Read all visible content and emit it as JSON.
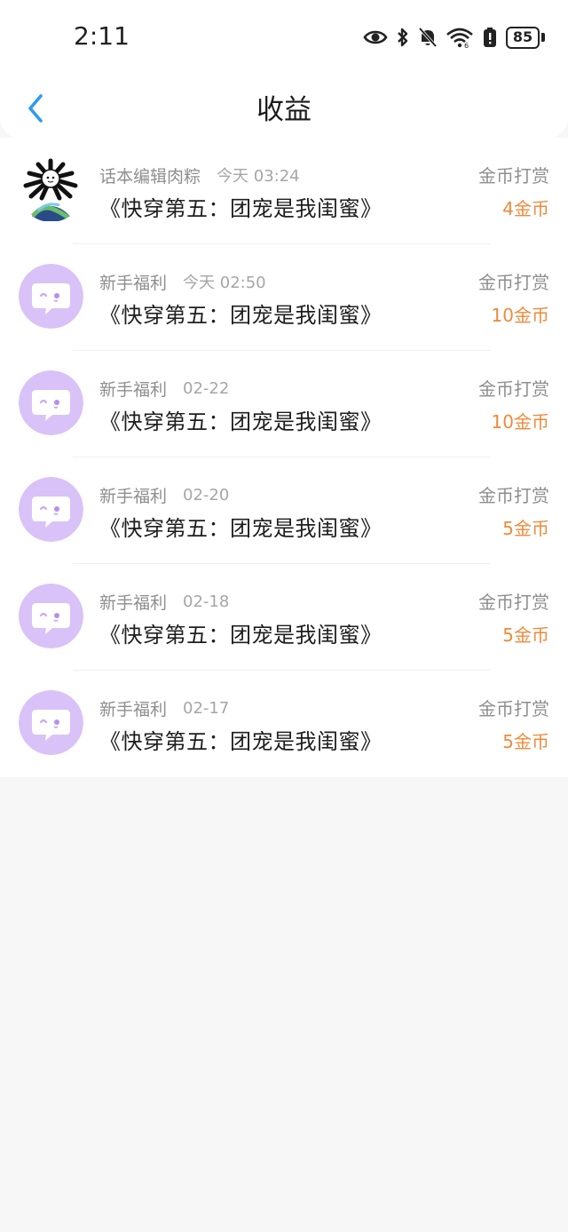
{
  "status_bar": {
    "time": "2:11",
    "battery": "85",
    "icons": [
      "eye-icon",
      "bluetooth-icon",
      "bell-muted-icon",
      "wifi-icon",
      "battery-alert-icon",
      "battery-icon"
    ]
  },
  "nav": {
    "back_icon": "chevron-left-icon",
    "title": "收益"
  },
  "colors": {
    "accent": "#2d9bf0",
    "amount": "#ee8a3a",
    "avatar_bg": "#d9c2f7"
  },
  "records": [
    {
      "avatar": "spiky-character-on-earth",
      "source": "话本编辑肉粽",
      "time": "今天 03:24",
      "book": "《快穿第五：团宠是我闺蜜》",
      "type": "金币打赏",
      "amount": "4金币"
    },
    {
      "avatar": "chat-bubble-icon",
      "source": "新手福利",
      "time": "今天 02:50",
      "book": "《快穿第五：团宠是我闺蜜》",
      "type": "金币打赏",
      "amount": "10金币"
    },
    {
      "avatar": "chat-bubble-icon",
      "source": "新手福利",
      "time": "02-22",
      "book": "《快穿第五：团宠是我闺蜜》",
      "type": "金币打赏",
      "amount": "10金币"
    },
    {
      "avatar": "chat-bubble-icon",
      "source": "新手福利",
      "time": "02-20",
      "book": "《快穿第五：团宠是我闺蜜》",
      "type": "金币打赏",
      "amount": "5金币"
    },
    {
      "avatar": "chat-bubble-icon",
      "source": "新手福利",
      "time": "02-18",
      "book": "《快穿第五：团宠是我闺蜜》",
      "type": "金币打赏",
      "amount": "5金币"
    },
    {
      "avatar": "chat-bubble-icon",
      "source": "新手福利",
      "time": "02-17",
      "book": "《快穿第五：团宠是我闺蜜》",
      "type": "金币打赏",
      "amount": "5金币"
    }
  ]
}
